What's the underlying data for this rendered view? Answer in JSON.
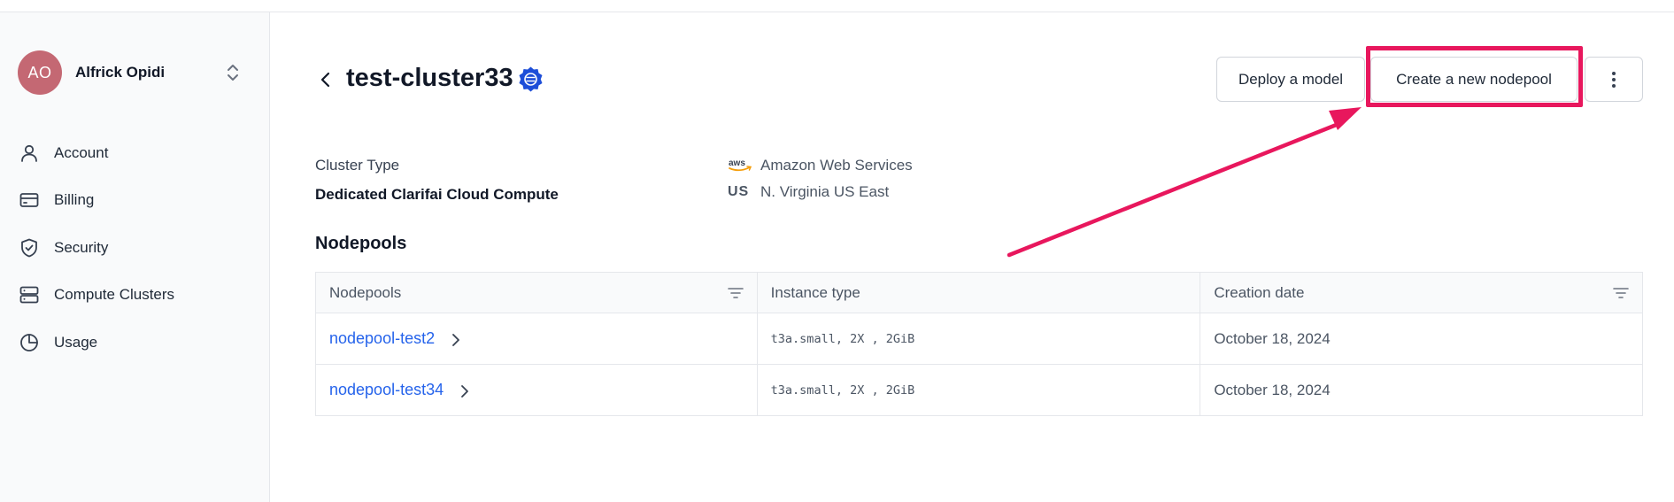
{
  "user": {
    "initials": "AO",
    "name": "Alfrick Opidi"
  },
  "sidebar": {
    "items": [
      {
        "label": "Account",
        "icon": "user-icon"
      },
      {
        "label": "Billing",
        "icon": "credit-card-icon"
      },
      {
        "label": "Security",
        "icon": "shield-icon"
      },
      {
        "label": "Compute Clusters",
        "icon": "server-icon"
      },
      {
        "label": "Usage",
        "icon": "pie-chart-icon"
      }
    ]
  },
  "header": {
    "title": "test-cluster33",
    "deploy_label": "Deploy a model",
    "create_label": "Create a new nodepool"
  },
  "cluster": {
    "type_label": "Cluster Type",
    "type_value": "Dedicated Clarifai Cloud Compute",
    "provider_icon_text": "aws",
    "provider": "Amazon Web Services",
    "region_code": "US",
    "region": "N. Virginia US East"
  },
  "nodepools": {
    "section_title": "Nodepools",
    "columns": [
      "Nodepools",
      "Instance type",
      "Creation date"
    ],
    "rows": [
      {
        "name": "nodepool-test2",
        "instance": "t3a.small, 2X , 2GiB",
        "created": "October 18, 2024"
      },
      {
        "name": "nodepool-test34",
        "instance": "t3a.small, 2X , 2GiB",
        "created": "October 18, 2024"
      }
    ]
  },
  "colors": {
    "accent": "#e8175d",
    "link": "#2563eb",
    "avatar": "#c46873",
    "badge": "#1d4ed8"
  }
}
